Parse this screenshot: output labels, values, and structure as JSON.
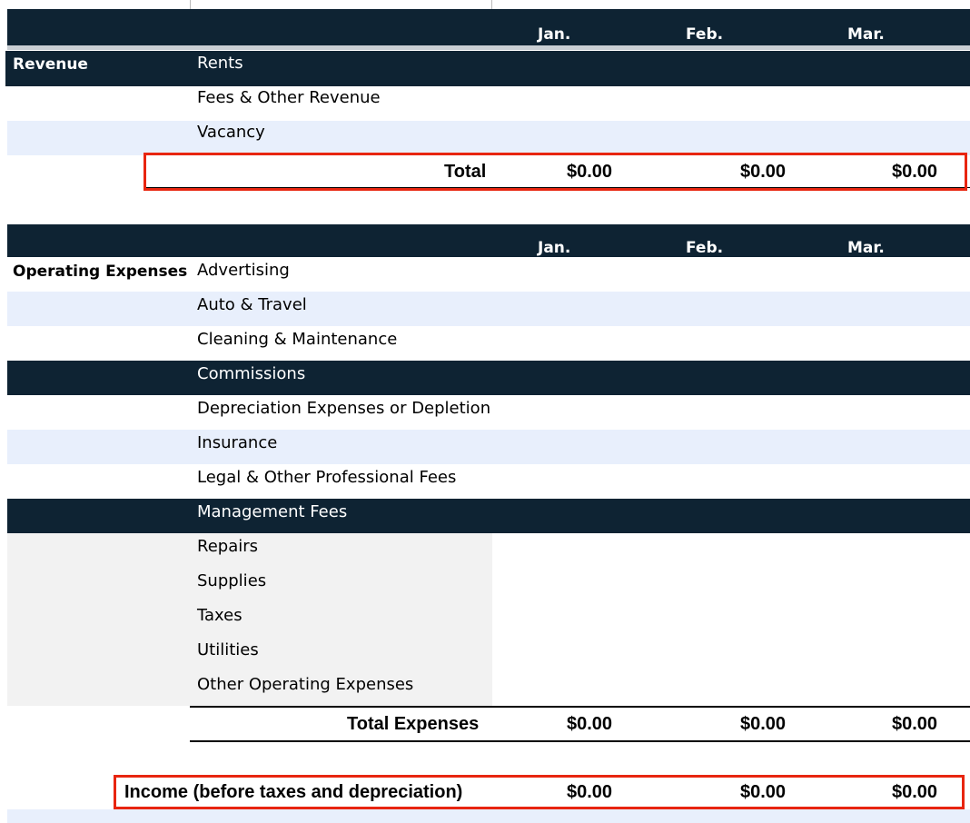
{
  "months": [
    "Jan.",
    "Feb.",
    "Mar."
  ],
  "revenue": {
    "section_label": "Revenue",
    "items": [
      "Rents",
      "Fees & Other Revenue",
      "Vacancy"
    ],
    "total_label": "Total",
    "totals": [
      "$0.00",
      "$0.00",
      "$0.00"
    ]
  },
  "expenses": {
    "section_label": "Operating Expenses",
    "items": [
      "Advertising",
      "Auto & Travel",
      "Cleaning & Maintenance",
      "Commissions",
      "Depreciation Expenses or Depletion",
      "Insurance",
      "Legal & Other Professional Fees",
      "Management Fees",
      "Repairs",
      "Supplies",
      "Taxes",
      "Utilities",
      "Other Operating Expenses"
    ],
    "total_label": "Total Expenses",
    "totals": [
      "$0.00",
      "$0.00",
      "$0.00"
    ]
  },
  "income": {
    "label": "Income (before taxes and depreciation)",
    "values": [
      "$0.00",
      "$0.00",
      "$0.00"
    ]
  },
  "colors": {
    "header_band": "#0e2333",
    "light_band": "#e8effc",
    "grey_band": "#f2f2f2",
    "highlight_box": "#e8250f"
  }
}
